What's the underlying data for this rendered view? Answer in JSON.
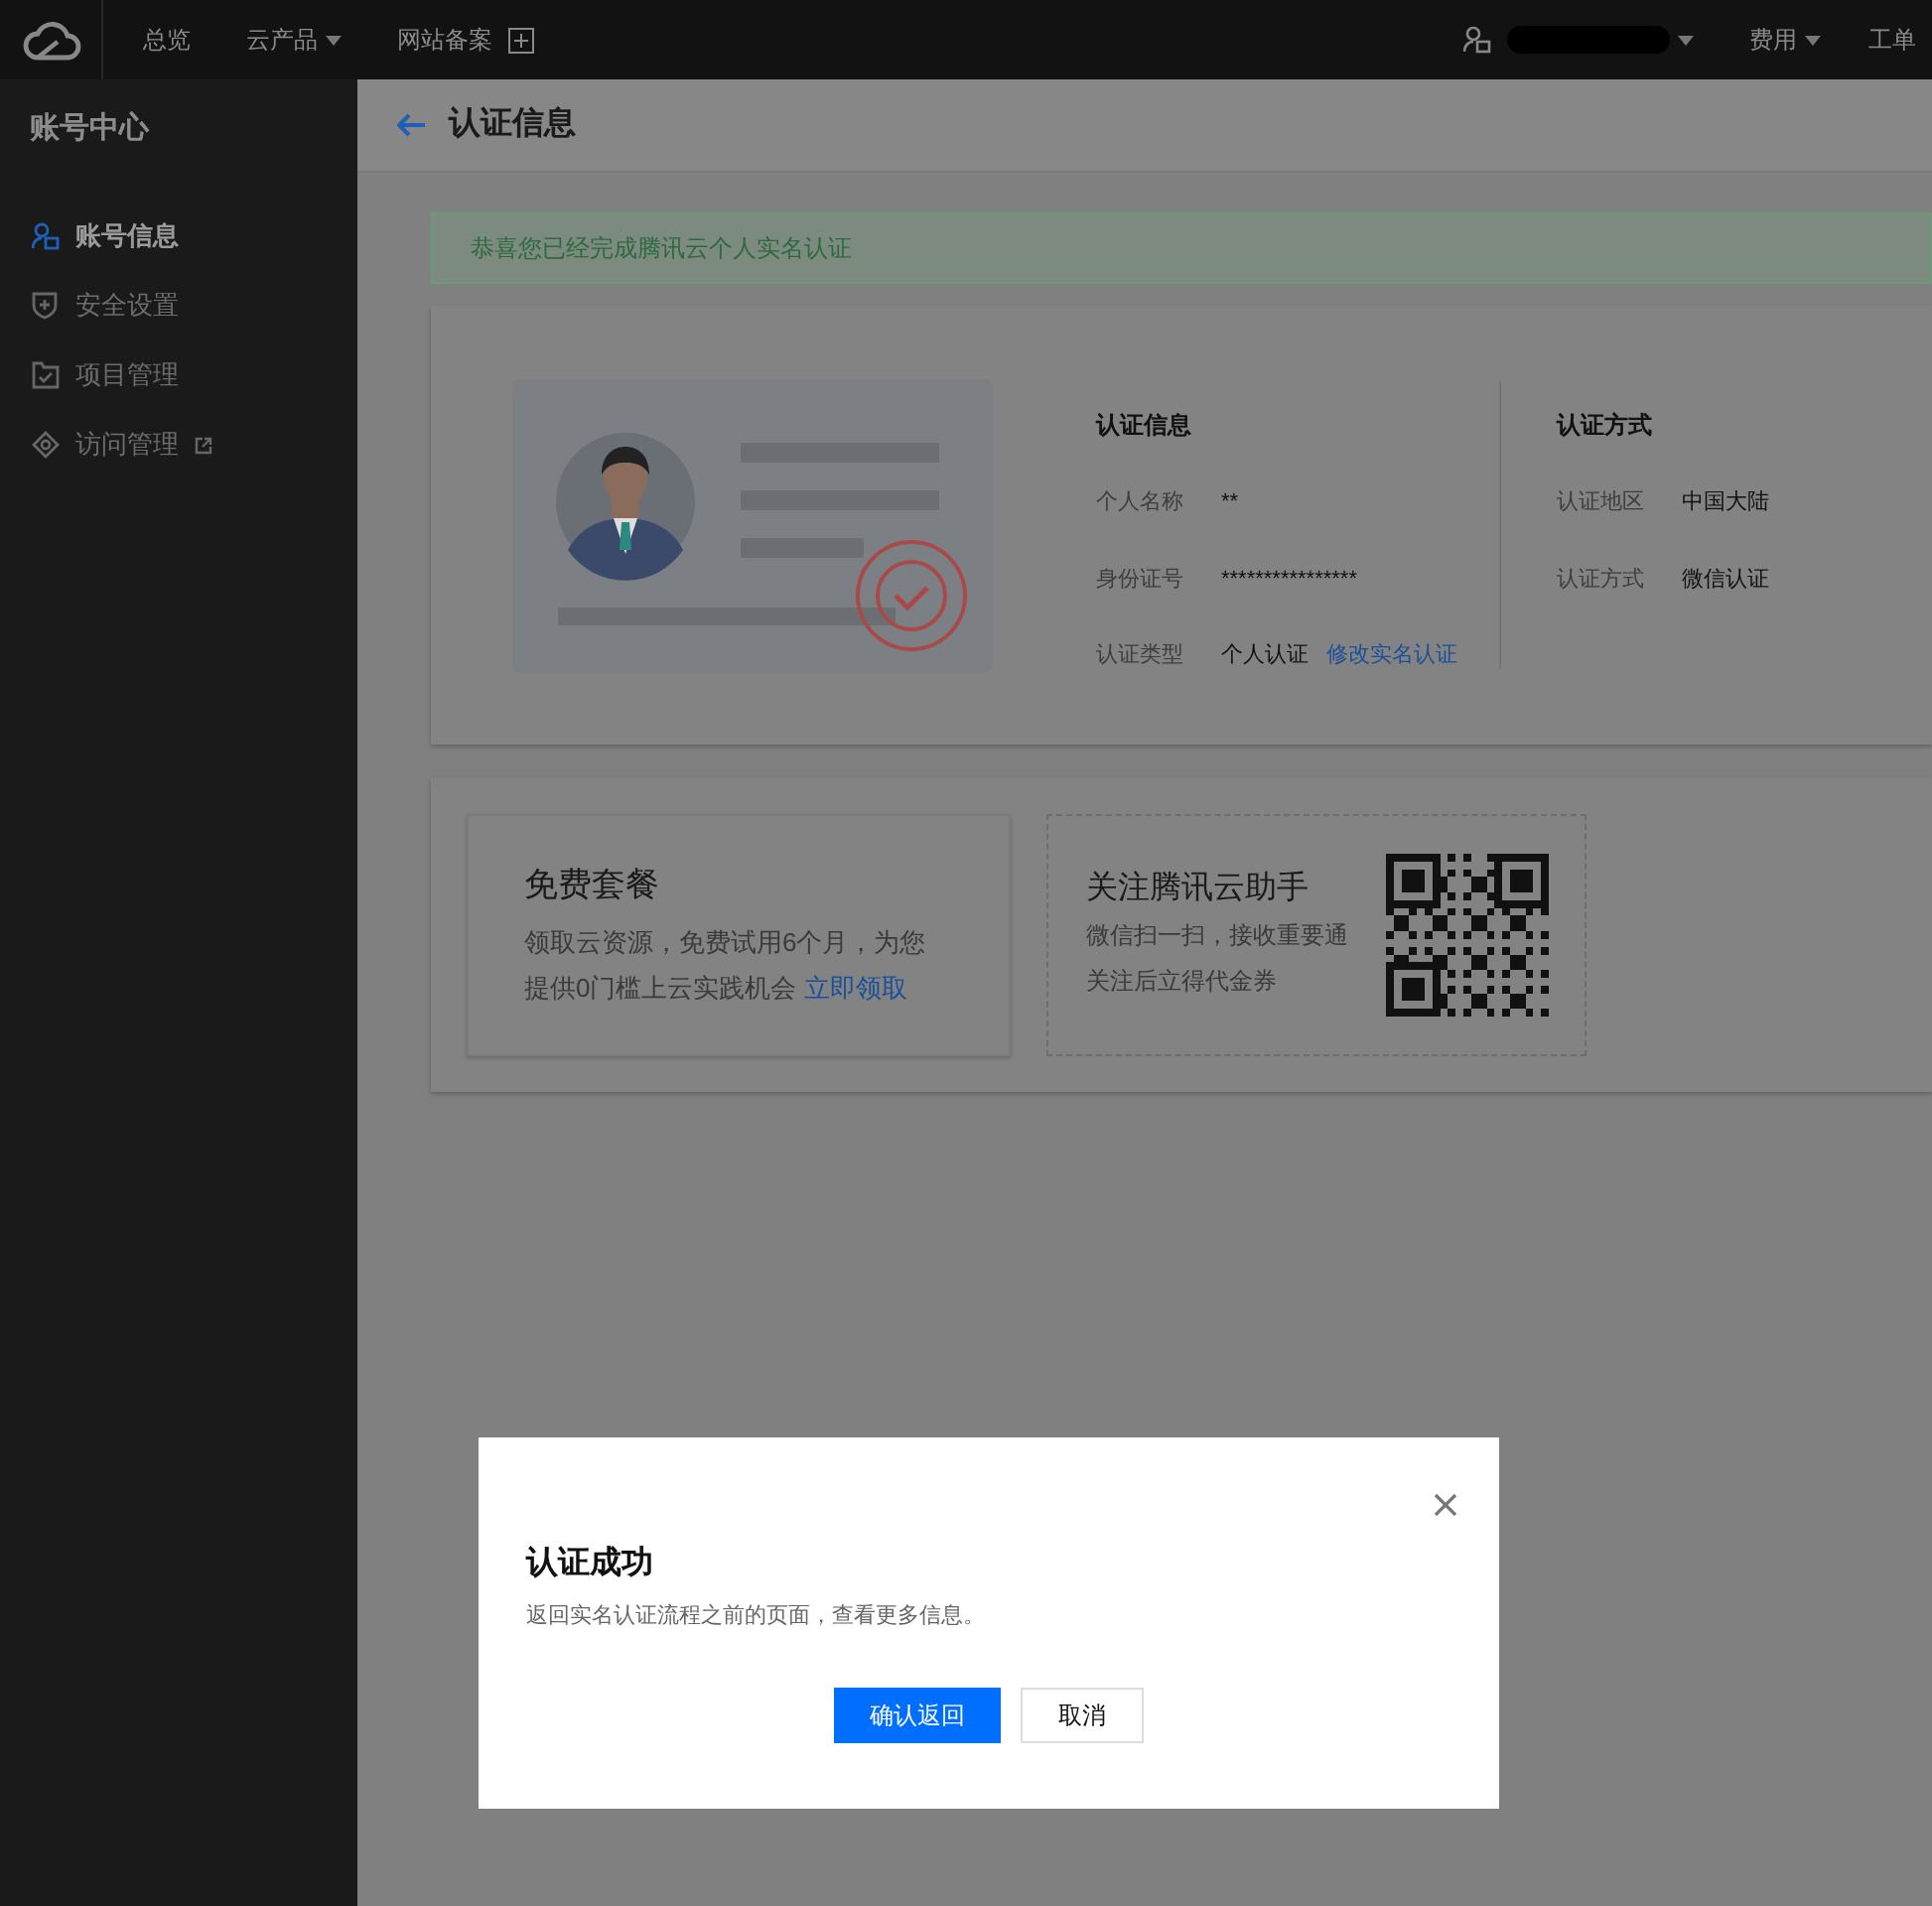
{
  "topbar": {
    "nav": [
      {
        "label": "总览",
        "kind": "plain"
      },
      {
        "label": "云产品",
        "kind": "dropdown"
      },
      {
        "label": "网站备案",
        "kind": "add"
      }
    ],
    "right": [
      {
        "label": "费用",
        "kind": "dropdown"
      },
      {
        "label": "工单",
        "kind": "plain"
      }
    ]
  },
  "sidebar": {
    "title": "账号中心",
    "items": [
      {
        "label": "账号信息",
        "kind": "user",
        "selected": true,
        "external": false
      },
      {
        "label": "安全设置",
        "kind": "shield",
        "selected": false,
        "external": false
      },
      {
        "label": "项目管理",
        "kind": "folder",
        "selected": false,
        "external": false
      },
      {
        "label": "访问管理",
        "kind": "access",
        "selected": false,
        "external": true
      }
    ]
  },
  "header": {
    "title": "认证信息"
  },
  "alert": "恭喜您已经完成腾讯云个人实名认证",
  "verification": {
    "info": {
      "title": "认证信息",
      "rows": [
        {
          "label": "个人名称",
          "value": "**"
        },
        {
          "label": "身份证号",
          "value": "****************"
        },
        {
          "label": "认证类型",
          "value": "个人认证",
          "link": "修改实名认证"
        }
      ]
    },
    "method": {
      "title": "认证方式",
      "rows": [
        {
          "label": "认证地区",
          "value": "中国大陆"
        },
        {
          "label": "认证方式",
          "value": "微信认证"
        }
      ]
    }
  },
  "promos": {
    "free": {
      "title": "免费套餐",
      "text": "领取云资源，免费试用6个月，为您提供0门槛上云实践机会",
      "link": "立即领取"
    },
    "follow": {
      "title": "关注腾讯云助手",
      "lines": [
        "微信扫一扫，接收重要通",
        "关注后立得代金券"
      ]
    }
  },
  "dialog": {
    "title": "认证成功",
    "message": "返回实名认证流程之前的页面，查看更多信息。",
    "buttons": [
      {
        "label": "确认返回",
        "kind": "primary"
      },
      {
        "label": "取消",
        "kind": "secondary"
      }
    ]
  }
}
